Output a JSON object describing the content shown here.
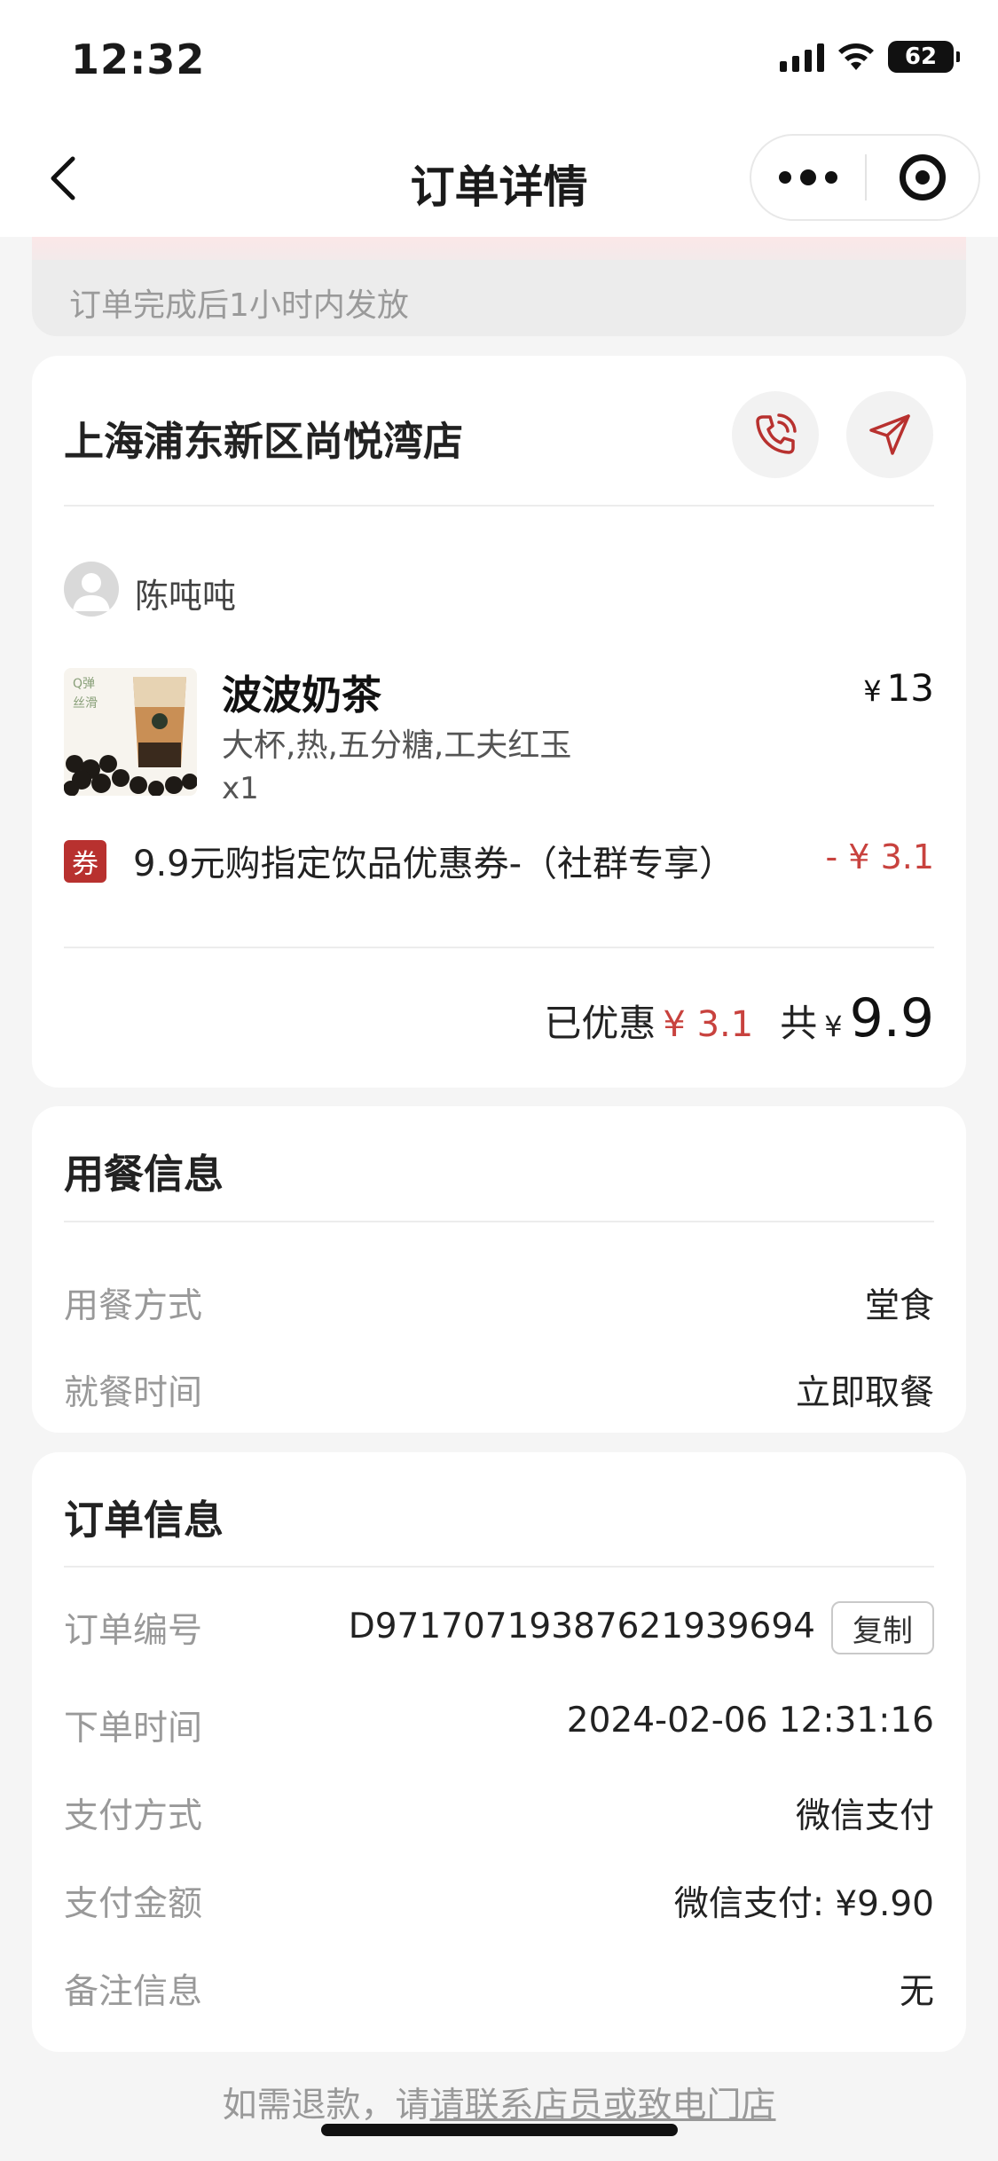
{
  "status_bar": {
    "time": "12:32",
    "battery": "62"
  },
  "nav": {
    "title": "订单详情"
  },
  "notice": {
    "text": "订单完成后1小时内发放"
  },
  "store": {
    "name": "上海浦东新区尚悦湾店",
    "user_name": "陈吨吨",
    "product": {
      "name": "波波奶茶",
      "price_symbol": "¥",
      "price": "13",
      "spec": "大杯,热,五分糖,工夫红玉",
      "qty": "x1",
      "image_text_1": "Q弹",
      "image_text_2": "丝滑"
    },
    "coupon": {
      "badge": "券",
      "text": "9.9元购指定饮品优惠券-（社群专享）",
      "discount": "- ¥ 3.1"
    },
    "total": {
      "saved_label": "已优惠",
      "saved_value": "¥ 3.1",
      "total_label": "共",
      "currency": "¥",
      "amount": "9.9"
    }
  },
  "dining": {
    "title": "用餐信息",
    "rows": [
      {
        "label": "用餐方式",
        "value": "堂食"
      },
      {
        "label": "就餐时间",
        "value": "立即取餐"
      }
    ]
  },
  "order": {
    "title": "订单信息",
    "order_no_label": "订单编号",
    "order_no": "D97170719387621939694",
    "copy_label": "复制",
    "rows": [
      {
        "label": "下单时间",
        "value": "2024-02-06 12:31:16"
      },
      {
        "label": "支付方式",
        "value": "微信支付"
      },
      {
        "label": "支付金额",
        "value": "微信支付: ¥9.90"
      },
      {
        "label": "备注信息",
        "value": "无"
      }
    ]
  },
  "footer": {
    "prefix": "如需退款，请",
    "link": "请联系店员或致电门店"
  },
  "colors": {
    "accent_red": "#c8423e",
    "badge_red": "#b8312f"
  }
}
